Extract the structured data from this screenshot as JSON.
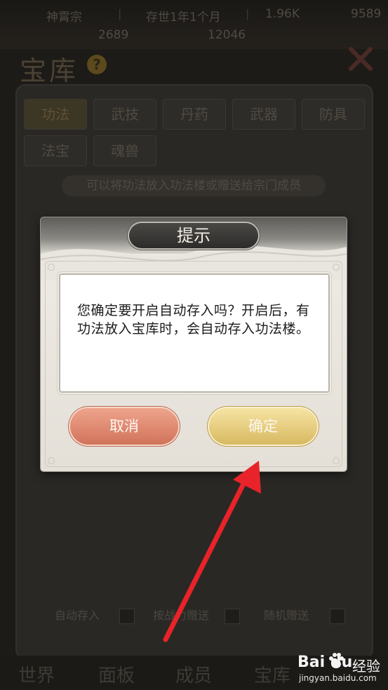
{
  "status_bar": {
    "sect": "神霄宗",
    "time": "存世1年1个月",
    "resource_a": "1.96K",
    "resource_b": "9589",
    "line2_a": "2689",
    "line2_b": "12046"
  },
  "vault": {
    "title": "宝库",
    "help_glyph": "?",
    "tabs": [
      "功法",
      "武技",
      "丹药",
      "武器",
      "防具",
      "法宝",
      "魂兽"
    ],
    "active_tab": "功法",
    "hint": "可以将功法放入功法楼或赠送给宗门成员",
    "auto_store_label": "自动存入",
    "gift_by_power_label": "按战力赠送",
    "random_gift_label": "随机赠送"
  },
  "bottom_nav": [
    "世界",
    "面板",
    "成员",
    "宝库"
  ],
  "dialog": {
    "title": "提示",
    "message": "您确定要开启自动存入吗？开启后，有功法放入宝库时，会自动存入功法楼。",
    "cancel_label": "取消",
    "confirm_label": "确定"
  },
  "watermark": {
    "brand": "Bai du",
    "brand_cn": "经验",
    "url": "jingyan.baidu.com"
  },
  "colors": {
    "annotation_arrow": "#e8232a",
    "cancel_button": "#e08a72",
    "confirm_button": "#e6cc7f",
    "dialog_title_bg": "#3a3937"
  },
  "icons": [
    "help-icon",
    "close-icon",
    "annotation-arrow",
    "baidu-paw-icon"
  ]
}
